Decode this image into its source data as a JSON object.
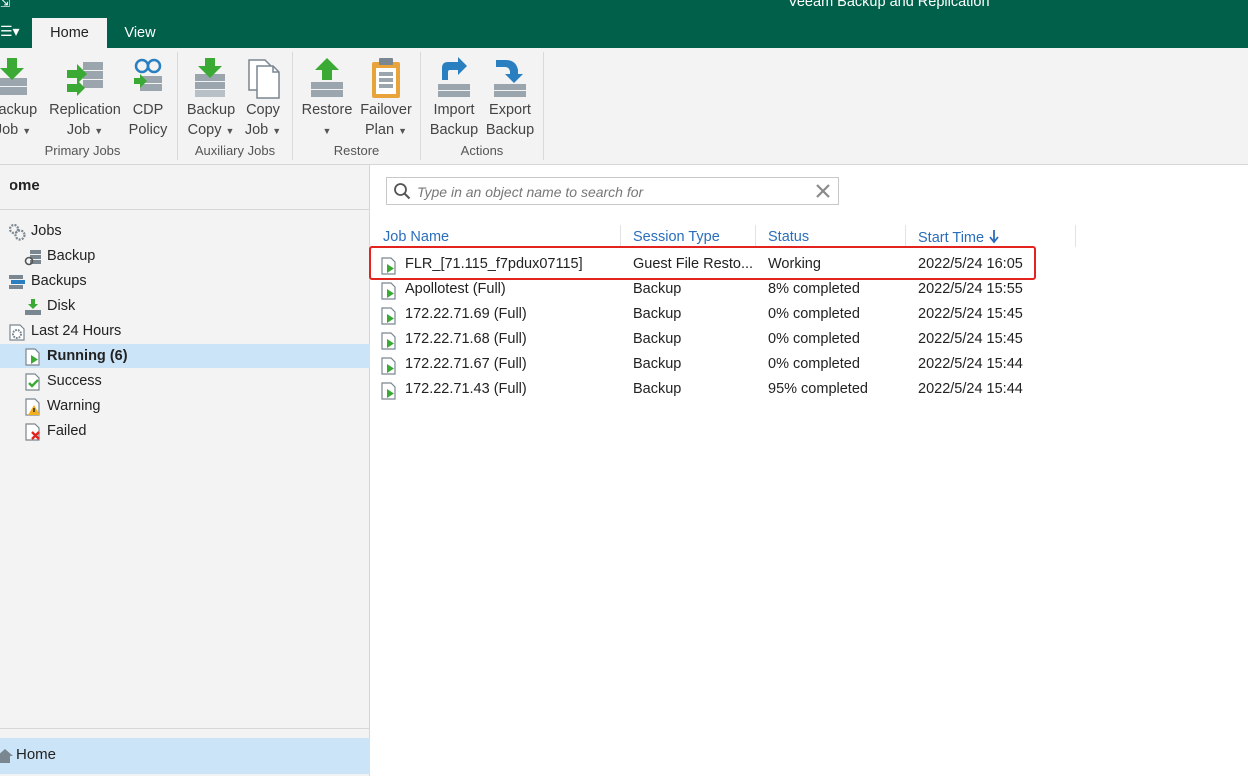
{
  "app": {
    "title": "Veeam Backup and Replication"
  },
  "menu": {
    "icon": "hamburger-menu-icon"
  },
  "tabs": [
    {
      "label": "Home"
    },
    {
      "label": "View"
    }
  ],
  "ribbon": {
    "groups": [
      {
        "label": "Primary Jobs",
        "buttons": [
          {
            "line1": "Backup",
            "line2": "Job",
            "icon": "backup-job-icon"
          },
          {
            "line1": "Replication",
            "line2": "Job",
            "icon": "replication-job-icon"
          },
          {
            "line1": "CDP",
            "line2": "Policy",
            "icon": "cdp-policy-icon"
          }
        ]
      },
      {
        "label": "Auxiliary Jobs",
        "buttons": [
          {
            "line1": "Backup",
            "line2": "Copy",
            "icon": "backup-copy-icon"
          },
          {
            "line1": "Copy",
            "line2": "Job",
            "icon": "copy-job-icon"
          }
        ]
      },
      {
        "label": "Restore",
        "buttons": [
          {
            "line1": "Restore",
            "line2": "",
            "icon": "restore-icon"
          },
          {
            "line1": "Failover",
            "line2": "Plan",
            "icon": "failover-plan-icon"
          }
        ]
      },
      {
        "label": "Actions",
        "buttons": [
          {
            "line1": "Import",
            "line2": "Backup",
            "icon": "import-backup-icon"
          },
          {
            "line1": "Export",
            "line2": "Backup",
            "icon": "export-backup-icon"
          }
        ]
      }
    ]
  },
  "nav": {
    "header": "Home",
    "tree": [
      {
        "label": "Jobs",
        "icon": "gears-icon"
      },
      {
        "label": "Backup",
        "icon": "backup-job-small-icon"
      },
      {
        "label": "Backups",
        "icon": "backups-icon"
      },
      {
        "label": "Disk",
        "icon": "disk-icon"
      },
      {
        "label": "Last 24 Hours",
        "icon": "gear-icon"
      },
      {
        "label": "Running (6)",
        "icon": "running-icon"
      },
      {
        "label": "Success",
        "icon": "success-icon"
      },
      {
        "label": "Warning",
        "icon": "warning-icon"
      },
      {
        "label": "Failed",
        "icon": "failed-icon"
      }
    ],
    "bottom": {
      "label": "Home",
      "icon": "home-icon"
    }
  },
  "search": {
    "placeholder": "Type in an object name to search for"
  },
  "table": {
    "columns": [
      "Job Name",
      "Session Type",
      "Status",
      "Start Time"
    ],
    "sort_icon": "sort-descending-arrow-icon",
    "rows": [
      {
        "name": "FLR_[71.115_f7pdux07115]",
        "type": "Guest File Resto...",
        "status": "Working",
        "start": "2022/5/24 16:05"
      },
      {
        "name": "Apollotest (Full)",
        "type": "Backup",
        "status": "8% completed",
        "start": "2022/5/24 15:55"
      },
      {
        "name": "172.22.71.69 (Full)",
        "type": "Backup",
        "status": "0% completed",
        "start": "2022/5/24 15:45"
      },
      {
        "name": "172.22.71.68 (Full)",
        "type": "Backup",
        "status": "0% completed",
        "start": "2022/5/24 15:45"
      },
      {
        "name": "172.22.71.67 (Full)",
        "type": "Backup",
        "status": "0% completed",
        "start": "2022/5/24 15:44"
      },
      {
        "name": "172.22.71.43 (Full)",
        "type": "Backup",
        "status": "95% completed",
        "start": "2022/5/24 15:44"
      }
    ]
  },
  "colors": {
    "brand": "#00604a",
    "accent": "#2a6ebb",
    "selection": "#cce4f7",
    "highlight": "#e3231d",
    "green": "#3aaa35"
  }
}
